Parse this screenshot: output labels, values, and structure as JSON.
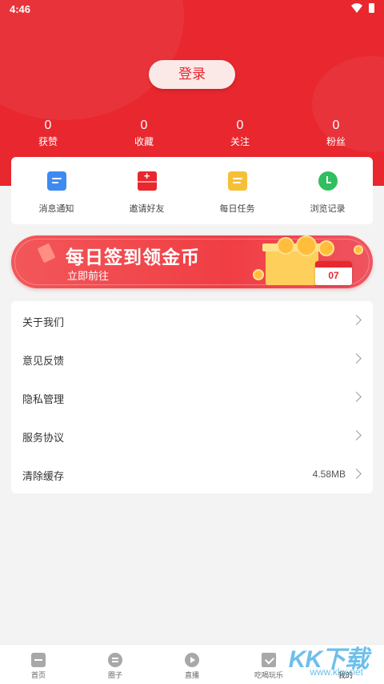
{
  "status_bar": {
    "time": "4:46",
    "wifi_icon": "wifi-icon",
    "battery_icon": "battery-icon"
  },
  "header": {
    "login_label": "登录",
    "background_color": "#e8272e"
  },
  "stats": [
    {
      "value": "0",
      "label": "获赞"
    },
    {
      "value": "0",
      "label": "收藏"
    },
    {
      "value": "0",
      "label": "关注"
    },
    {
      "value": "0",
      "label": "粉丝"
    }
  ],
  "quick_actions": [
    {
      "label": "消息通知",
      "icon": "message-icon",
      "color": "#3d8bf2"
    },
    {
      "label": "邀请好友",
      "icon": "invite-envelope-icon",
      "color": "#e8272e"
    },
    {
      "label": "每日任务",
      "icon": "task-icon",
      "color": "#f5c036"
    },
    {
      "label": "浏览记录",
      "icon": "history-clock-icon",
      "color": "#2fbf5f"
    }
  ],
  "banner": {
    "title": "每日签到领金币",
    "subtitle": "立即前往",
    "calendar_day": "07"
  },
  "settings": [
    {
      "label": "关于我们",
      "value": ""
    },
    {
      "label": "意见反馈",
      "value": ""
    },
    {
      "label": "隐私管理",
      "value": ""
    },
    {
      "label": "服务协议",
      "value": ""
    },
    {
      "label": "清除缓存",
      "value": "4.58MB"
    }
  ],
  "bottom_nav": [
    {
      "label": "首页",
      "icon": "home-icon"
    },
    {
      "label": "圈子",
      "icon": "community-icon"
    },
    {
      "label": "直播",
      "icon": "live-play-icon"
    },
    {
      "label": "吃喝玩乐",
      "icon": "food-fun-icon"
    },
    {
      "label": "我的",
      "icon": "profile-icon",
      "active": true
    }
  ],
  "watermark": {
    "text": "KK下载",
    "url": "www.kkx.net"
  }
}
